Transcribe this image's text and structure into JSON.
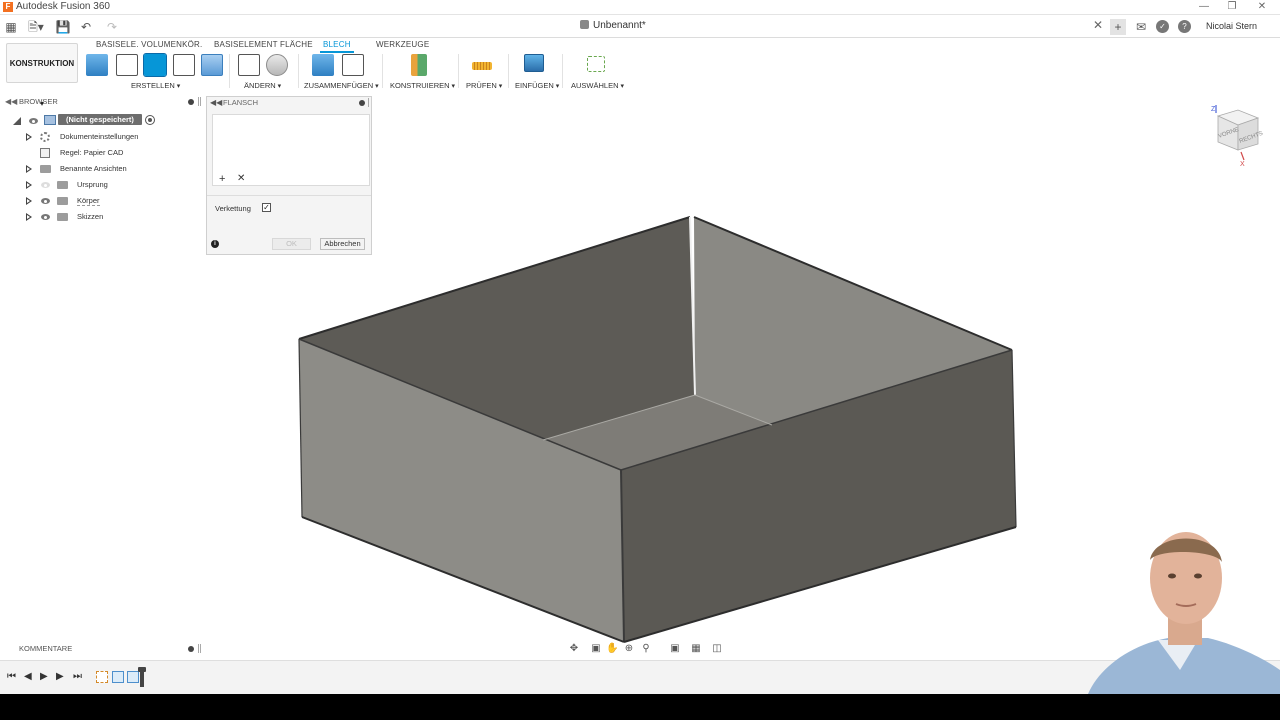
{
  "app": {
    "title": "Autodesk Fusion 360",
    "document_tab": "Unbenannt*",
    "user": "Nicolai Stern",
    "workspace": "KONSTRUKTION"
  },
  "toolbar": {
    "tabs": [
      "BASISELE. VOLUMENKÖR.",
      "BASISELEMENT FLÄCHE",
      "BLECH",
      "WERKZEUGE"
    ],
    "active_tab": "BLECH",
    "groups": [
      "ERSTELLEN",
      "ÄNDERN",
      "ZUSAMMENFÜGEN",
      "KONSTRUIEREN",
      "PRÜFEN",
      "EINFÜGEN",
      "AUSWÄHLEN"
    ]
  },
  "browser": {
    "title": "BROWSER",
    "root": "(Nicht gespeichert)",
    "items": [
      {
        "label": "Dokumenteinstellungen",
        "icon": "gear-icon"
      },
      {
        "label": "Regel: Papier CAD",
        "icon": "rule-icon"
      },
      {
        "label": "Benannte Ansichten",
        "icon": "folder-icon"
      },
      {
        "label": "Ursprung",
        "icon": "folder-icon"
      },
      {
        "label": "Körper",
        "icon": "folder-icon"
      },
      {
        "label": "Skizzen",
        "icon": "folder-icon"
      }
    ]
  },
  "dialog": {
    "title": "FLANSCH",
    "chain_label": "Verkettung",
    "chain_checked": true,
    "ok_label": "OK",
    "cancel_label": "Abbrechen"
  },
  "viewcube": {
    "front": "VORNE",
    "right": "RECHTS",
    "axis_z": "Z",
    "axis_x": "X"
  },
  "comments": {
    "title": "KOMMENTARE"
  },
  "colors": {
    "accent": "#0696d7",
    "model_light": "#8f8f8a",
    "model_dark": "#5b5954"
  }
}
